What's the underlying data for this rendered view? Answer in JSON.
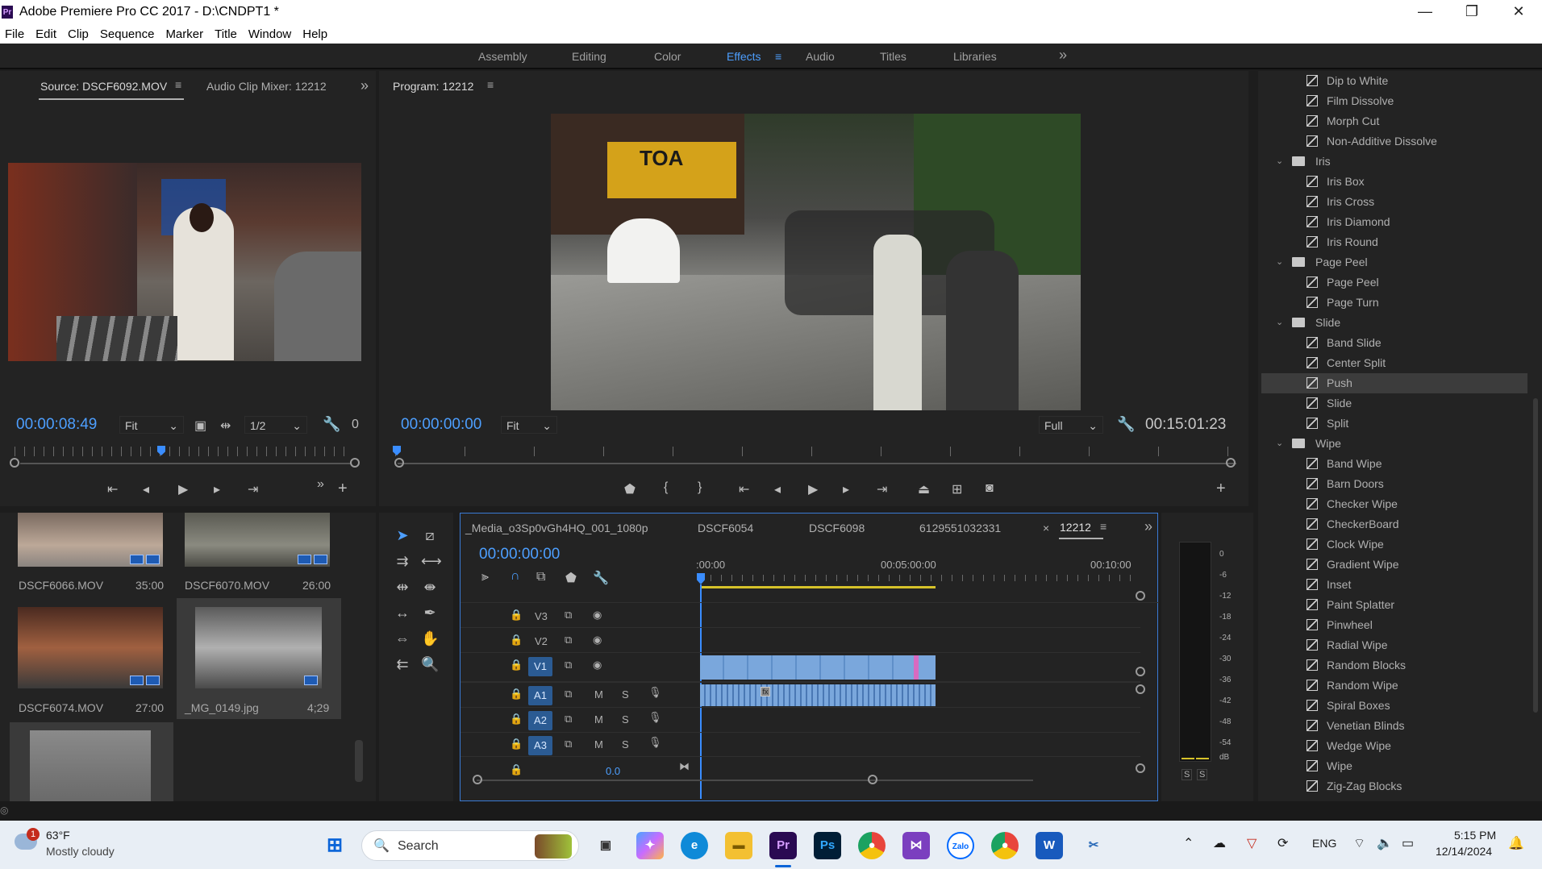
{
  "app": {
    "title": "Adobe Premiere Pro CC 2017 - D:\\CNDPT1 *",
    "logo": "Pr"
  },
  "window_buttons": {
    "minimize": "—",
    "maximize": "❐",
    "close": "✕"
  },
  "menu": [
    "File",
    "Edit",
    "Clip",
    "Sequence",
    "Marker",
    "Title",
    "Window",
    "Help"
  ],
  "workspaces": {
    "items": [
      "Assembly",
      "Editing",
      "Color",
      "Effects",
      "Audio",
      "Titles",
      "Libraries"
    ],
    "active": "Effects",
    "overflow": "»"
  },
  "source": {
    "tab": "Source: DSCF6092.MOV",
    "tab2": "Audio Clip Mixer: 12212",
    "timecode": "00:00:08:49",
    "zoom": "Fit",
    "resolution": "1/2",
    "trail": "0"
  },
  "program": {
    "tab": "Program: 12212",
    "timecode": "00:00:00:00",
    "zoom": "Fit",
    "quality": "Full",
    "duration": "00:15:01:23"
  },
  "project_items": [
    {
      "name": "DSCF6066.MOV",
      "duration": "35:00"
    },
    {
      "name": "DSCF6070.MOV",
      "duration": "26:00"
    },
    {
      "name": "DSCF6074.MOV",
      "duration": "27:00"
    },
    {
      "name": "_MG_0149.jpg",
      "duration": "4;29"
    }
  ],
  "timeline": {
    "tabs": [
      "_Media_o3Sp0vGh4HQ_001_1080p",
      "DSCF6054",
      "DSCF6098",
      "6129551032331",
      "12212"
    ],
    "active_tab": "12212",
    "timecode": "00:00:00:00",
    "ruler": [
      ":00:00",
      "00:05:00:00",
      "00:10:00"
    ],
    "video_tracks": [
      "V3",
      "V2",
      "V1"
    ],
    "audio_tracks": [
      "A1",
      "A2",
      "A3"
    ],
    "mute": "M",
    "solo": "S",
    "master_vol": "0.0"
  },
  "meter": {
    "ticks": [
      "0",
      "-6",
      "-12",
      "-18",
      "-24",
      "-30",
      "-36",
      "-42",
      "-48",
      "-54",
      "dB"
    ],
    "solo": [
      "S",
      "S"
    ]
  },
  "effects": [
    {
      "type": "item",
      "label": "Dip to White"
    },
    {
      "type": "item",
      "label": "Film Dissolve"
    },
    {
      "type": "item",
      "label": "Morph Cut"
    },
    {
      "type": "item",
      "label": "Non-Additive Dissolve"
    },
    {
      "type": "folder",
      "label": "Iris"
    },
    {
      "type": "item",
      "label": "Iris Box"
    },
    {
      "type": "item",
      "label": "Iris Cross"
    },
    {
      "type": "item",
      "label": "Iris Diamond"
    },
    {
      "type": "item",
      "label": "Iris Round"
    },
    {
      "type": "folder",
      "label": "Page Peel"
    },
    {
      "type": "item",
      "label": "Page Peel"
    },
    {
      "type": "item",
      "label": "Page Turn"
    },
    {
      "type": "folder",
      "label": "Slide"
    },
    {
      "type": "item",
      "label": "Band Slide"
    },
    {
      "type": "item",
      "label": "Center Split"
    },
    {
      "type": "item",
      "label": "Push",
      "selected": true
    },
    {
      "type": "item",
      "label": "Slide"
    },
    {
      "type": "item",
      "label": "Split"
    },
    {
      "type": "folder",
      "label": "Wipe"
    },
    {
      "type": "item",
      "label": "Band Wipe"
    },
    {
      "type": "item",
      "label": "Barn Doors"
    },
    {
      "type": "item",
      "label": "Checker Wipe"
    },
    {
      "type": "item",
      "label": "CheckerBoard"
    },
    {
      "type": "item",
      "label": "Clock Wipe"
    },
    {
      "type": "item",
      "label": "Gradient Wipe"
    },
    {
      "type": "item",
      "label": "Inset"
    },
    {
      "type": "item",
      "label": "Paint Splatter"
    },
    {
      "type": "item",
      "label": "Pinwheel"
    },
    {
      "type": "item",
      "label": "Radial Wipe"
    },
    {
      "type": "item",
      "label": "Random Blocks"
    },
    {
      "type": "item",
      "label": "Random Wipe"
    },
    {
      "type": "item",
      "label": "Spiral Boxes"
    },
    {
      "type": "item",
      "label": "Venetian Blinds"
    },
    {
      "type": "item",
      "label": "Wedge Wipe"
    },
    {
      "type": "item",
      "label": "Wipe"
    },
    {
      "type": "item",
      "label": "Zig-Zag Blocks"
    }
  ],
  "taskbar": {
    "weather_temp": "63°F",
    "weather_desc": "Mostly cloudy",
    "weather_badge": "1",
    "search": "Search",
    "language": "ENG",
    "time": "5:15 PM",
    "date": "12/14/2024",
    "apps": [
      "Start",
      "Search",
      "File Explorer",
      "Task View",
      "Copilot",
      "Edge",
      "Folder",
      "Premiere Pro",
      "Photoshop",
      "Chrome",
      "Visual Studio",
      "Zalo",
      "Chrome Profile",
      "Word",
      "Snipping Tool"
    ]
  },
  "colors": {
    "accent": "#4d9fff",
    "panel": "#232323",
    "clip": "#7aa7dc",
    "track_button": "#2b5b93"
  }
}
